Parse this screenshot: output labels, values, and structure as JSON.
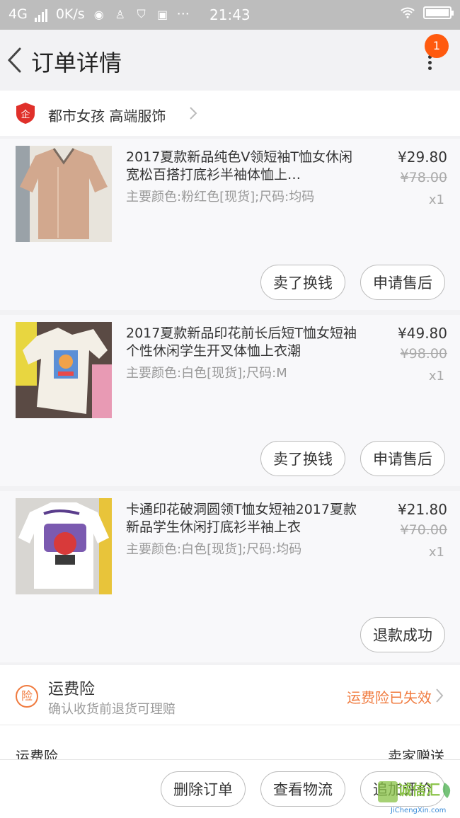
{
  "status_bar": {
    "network": "4G",
    "speed": "0K/s",
    "time": "21:43",
    "more": "···"
  },
  "header": {
    "title": "订单详情",
    "badge_count": "1"
  },
  "shop": {
    "logo_text": "企",
    "name": "都市女孩 高端服饰"
  },
  "items": [
    {
      "title": "2017夏款新品纯色V领短袖T恤女休闲宽松百搭打底衫半袖体恤上…",
      "spec": "主要颜色:粉红色[现货];尺码:均码",
      "price": "¥29.80",
      "original_price": "¥78.00",
      "quantity": "x1",
      "actions": [
        "卖了换钱",
        "申请售后"
      ]
    },
    {
      "title": "2017夏款新品印花前长后短T恤女短袖个性休闲学生开叉体恤上衣潮",
      "spec": "主要颜色:白色[现货];尺码:M",
      "price": "¥49.80",
      "original_price": "¥98.00",
      "quantity": "x1",
      "actions": [
        "卖了换钱",
        "申请售后"
      ]
    },
    {
      "title": "卡通印花破洞圆领T恤女短袖2017夏款新品学生休闲打底衫半袖上衣",
      "spec": "主要颜色:白色[现货];尺码:均码",
      "price": "¥21.80",
      "original_price": "¥70.00",
      "quantity": "x1",
      "actions": [
        "退款成功"
      ]
    }
  ],
  "insurance": {
    "icon_text": "险",
    "title": "运费险",
    "subtitle": "确认收货前退货可理赔",
    "status": "运费险已失效"
  },
  "fee_row": {
    "label": "运费险",
    "value": "卖家赠送"
  },
  "bottom_actions": {
    "delete": "删除订单",
    "logistics": "查看物流",
    "review": "追加评价"
  },
  "watermark": {
    "text": "诚信汇",
    "url": "JiChengXin.com"
  },
  "colors": {
    "accent": "#f07b3f",
    "badge": "#ff5a0e",
    "shop_logo": "#e0302a"
  }
}
